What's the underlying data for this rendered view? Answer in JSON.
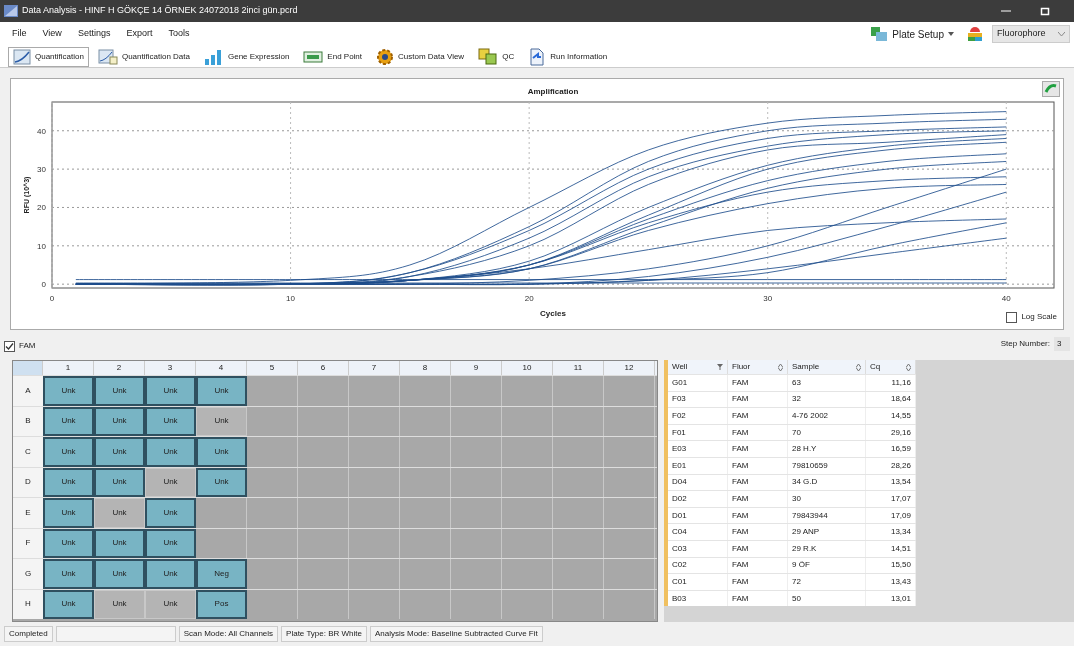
{
  "window": {
    "title": "Data Analysis - HINF H GÖKÇE 14 ÖRNEK 24072018 2inci gün.pcrd"
  },
  "menu": [
    "File",
    "View",
    "Settings",
    "Export",
    "Tools"
  ],
  "plate_setup": {
    "label": "Plate Setup"
  },
  "fluorophore": {
    "value": "Fluorophore"
  },
  "tabs": [
    {
      "label": "Quantification",
      "selected": true
    },
    {
      "label": "Quantification Data",
      "selected": false
    },
    {
      "label": "Gene Expression",
      "selected": false
    },
    {
      "label": "End Point",
      "selected": false
    },
    {
      "label": "Custom Data View",
      "selected": false
    },
    {
      "label": "QC",
      "selected": false
    },
    {
      "label": "Run Information",
      "selected": false
    }
  ],
  "chart": {
    "log_scale": {
      "label": "Log Scale",
      "checked": false
    },
    "chart_data": {
      "type": "line",
      "title": "Amplification",
      "xlabel": "Cycles",
      "ylabel": "RFU (10^3)",
      "x": [
        1,
        10,
        15,
        20,
        25,
        30,
        35,
        40
      ],
      "xlim": [
        0,
        42
      ],
      "ylim": [
        -1,
        47.5
      ],
      "xticks": [
        0,
        10,
        20,
        30,
        40
      ],
      "yticks": [
        0,
        10,
        20,
        30,
        40
      ],
      "grid": true,
      "series": [
        {
          "color": "#1f4e8c",
          "values": [
            0,
            1,
            5,
            20,
            35,
            42,
            44,
            45
          ]
        },
        {
          "color": "#1f4e8c",
          "values": [
            0,
            0,
            3,
            15,
            32,
            40,
            42,
            43
          ]
        },
        {
          "color": "#1f4e8c",
          "values": [
            0,
            0,
            3,
            14,
            30,
            38,
            40,
            41
          ]
        },
        {
          "color": "#1f4e8c",
          "values": [
            0,
            0,
            2,
            12,
            28,
            36,
            39,
            40
          ]
        },
        {
          "color": "#1f4e8c",
          "values": [
            0,
            0,
            2,
            10,
            26,
            35,
            37,
            39
          ]
        },
        {
          "color": "#1f4e8c",
          "values": [
            0,
            0,
            1,
            6,
            20,
            31,
            36,
            38
          ]
        },
        {
          "color": "#1f4e8c",
          "values": [
            0,
            0,
            1,
            5,
            18,
            30,
            35,
            37
          ]
        },
        {
          "color": "#1f4e8c",
          "values": [
            0,
            0,
            1,
            5,
            17,
            27,
            32,
            34
          ]
        },
        {
          "color": "#1f4e8c",
          "values": [
            0,
            0,
            1,
            4,
            15,
            25,
            30,
            32
          ]
        },
        {
          "color": "#1f4e8c",
          "values": [
            0,
            0,
            1,
            5,
            16,
            24,
            27,
            28
          ]
        },
        {
          "color": "#1f4e8c",
          "values": [
            0,
            0,
            1,
            4,
            14,
            21,
            25,
            26
          ]
        },
        {
          "color": "#1f4e8c",
          "values": [
            0,
            0,
            1,
            4,
            9,
            14,
            16,
            17
          ]
        },
        {
          "color": "#1f4e8c",
          "values": [
            0,
            0,
            0,
            1,
            4,
            10,
            20,
            30
          ]
        },
        {
          "color": "#1f4e8c",
          "values": [
            0,
            0,
            0,
            0,
            2,
            7,
            15,
            24
          ]
        },
        {
          "color": "#1f4e8c",
          "values": [
            0,
            0,
            0,
            0,
            1,
            3,
            10,
            16
          ]
        },
        {
          "color": "#1f4e8c",
          "values": [
            0,
            0,
            0,
            0,
            1,
            4,
            8,
            12
          ]
        },
        {
          "color": "#1f4e8c",
          "values": [
            1.2,
            1.2,
            1.2,
            1.2,
            1.2,
            1.2,
            1.2,
            1.2
          ]
        },
        {
          "color": "#1f4e8c",
          "values": [
            0.3,
            0.3,
            0.3,
            0.3,
            0.3,
            0.3,
            0.3,
            0.3
          ]
        }
      ]
    }
  },
  "fluor_filter": {
    "label": "FAM",
    "checked": true
  },
  "step_number": {
    "label": "Step Number:",
    "value": "3"
  },
  "plate": {
    "columns": [
      "1",
      "2",
      "3",
      "4",
      "5",
      "6",
      "7",
      "8",
      "9",
      "10",
      "11",
      "12"
    ],
    "rows": [
      {
        "label": "A",
        "wells": [
          {
            "text": "Unk",
            "selected": true
          },
          {
            "text": "Unk",
            "selected": true
          },
          {
            "text": "Unk",
            "selected": true
          },
          {
            "text": "Unk",
            "selected": true
          }
        ]
      },
      {
        "label": "B",
        "wells": [
          {
            "text": "Unk",
            "selected": true
          },
          {
            "text": "Unk",
            "selected": true
          },
          {
            "text": "Unk",
            "selected": true
          },
          {
            "text": "Unk",
            "selected": false
          }
        ]
      },
      {
        "label": "C",
        "wells": [
          {
            "text": "Unk",
            "selected": true
          },
          {
            "text": "Unk",
            "selected": true
          },
          {
            "text": "Unk",
            "selected": true
          },
          {
            "text": "Unk",
            "selected": true
          }
        ]
      },
      {
        "label": "D",
        "wells": [
          {
            "text": "Unk",
            "selected": true
          },
          {
            "text": "Unk",
            "selected": true
          },
          {
            "text": "Unk",
            "selected": false
          },
          {
            "text": "Unk",
            "selected": true
          }
        ]
      },
      {
        "label": "E",
        "wells": [
          {
            "text": "Unk",
            "selected": true
          },
          {
            "text": "Unk",
            "selected": false
          },
          {
            "text": "Unk",
            "selected": true
          }
        ]
      },
      {
        "label": "F",
        "wells": [
          {
            "text": "Unk",
            "selected": true
          },
          {
            "text": "Unk",
            "selected": true
          },
          {
            "text": "Unk",
            "selected": true
          }
        ]
      },
      {
        "label": "G",
        "wells": [
          {
            "text": "Unk",
            "selected": true
          },
          {
            "text": "Unk",
            "selected": true
          },
          {
            "text": "Unk",
            "selected": true
          },
          {
            "text": "Neg",
            "selected": true
          }
        ]
      },
      {
        "label": "H",
        "wells": [
          {
            "text": "Unk",
            "selected": true
          },
          {
            "text": "Unk",
            "selected": false
          },
          {
            "text": "Unk",
            "selected": false
          },
          {
            "text": "Pos",
            "selected": true
          }
        ]
      }
    ]
  },
  "table": {
    "columns": [
      {
        "label": "Well",
        "kind": "filter"
      },
      {
        "label": "Fluor",
        "kind": "sort"
      },
      {
        "label": "Sample",
        "kind": "sort"
      },
      {
        "label": "Cq",
        "kind": "sort"
      }
    ],
    "rows": [
      [
        "G01",
        "FAM",
        "63",
        "11,16"
      ],
      [
        "F03",
        "FAM",
        "32",
        "18,64"
      ],
      [
        "F02",
        "FAM",
        "4-76 2002",
        "14,55"
      ],
      [
        "F01",
        "FAM",
        "70",
        "29,16"
      ],
      [
        "E03",
        "FAM",
        "28 H.Y",
        "16,59"
      ],
      [
        "E01",
        "FAM",
        "79810659",
        "28,26"
      ],
      [
        "D04",
        "FAM",
        "34 G.D",
        "13,54"
      ],
      [
        "D02",
        "FAM",
        "30",
        "17,07"
      ],
      [
        "D01",
        "FAM",
        "79843944",
        "17,09"
      ],
      [
        "C04",
        "FAM",
        "29 ANP",
        "13,34"
      ],
      [
        "C03",
        "FAM",
        "29 R.K",
        "14,51"
      ],
      [
        "C02",
        "FAM",
        "9 ÖF",
        "15,50"
      ],
      [
        "C01",
        "FAM",
        "72",
        "13,43"
      ],
      [
        "B03",
        "FAM",
        "50",
        "13,01"
      ]
    ]
  },
  "status_bar": [
    "Completed",
    "Scan Mode: All Channels",
    "Plate Type: BR White",
    "Analysis Mode: Baseline Subtracted Curve Fit"
  ]
}
